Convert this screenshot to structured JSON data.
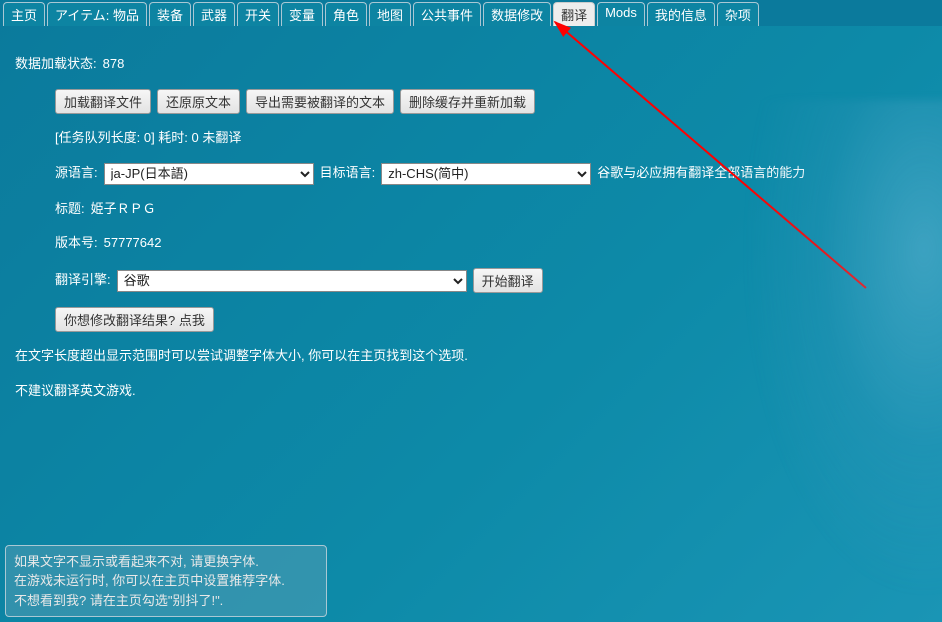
{
  "tabs": [
    "主页",
    "アイテム: 物品",
    "装备",
    "武器",
    "开关",
    "变量",
    "角色",
    "地图",
    "公共事件",
    "数据修改",
    "翻译",
    "Mods",
    "我的信息",
    "杂项"
  ],
  "active_tab_index": 10,
  "status_label": "数据加载状态: ",
  "status_value": "878",
  "buttons": {
    "load_file": "加载翻译文件",
    "restore": "还原原文本",
    "export": "导出需要被翻译的文本",
    "clear_cache": "删除缓存并重新加载",
    "start_translate": "开始翻译",
    "modify_result": "你想修改翻译结果? 点我"
  },
  "queue_text": "[任务队列长度: 0] 耗时: 0 未翻译",
  "src_lang_label": "源语言:",
  "tgt_lang_label": "目标语言:",
  "src_lang_value": "ja-JP(日本語)",
  "tgt_lang_value": "zh-CHS(简中)",
  "lang_note": "谷歌与必应拥有翻译全部语言的能力",
  "title_label": "标题: ",
  "title_value": "姫子ＲＰＧ",
  "version_label": "版本号: ",
  "version_value": "57777642",
  "engine_label": "翻译引擎:",
  "engine_value": "谷歌",
  "tip1": "在文字长度超出显示范围时可以尝试调整字体大小, 你可以在主页找到这个选项.",
  "tip2": "不建议翻译英文游戏.",
  "footnote1": "如果文字不显示或看起来不对, 请更换字体.",
  "footnote2": "在游戏未运行时, 你可以在主页中设置推荐字体.",
  "footnote3": "不想看到我? 请在主页勾选\"别抖了!\"."
}
